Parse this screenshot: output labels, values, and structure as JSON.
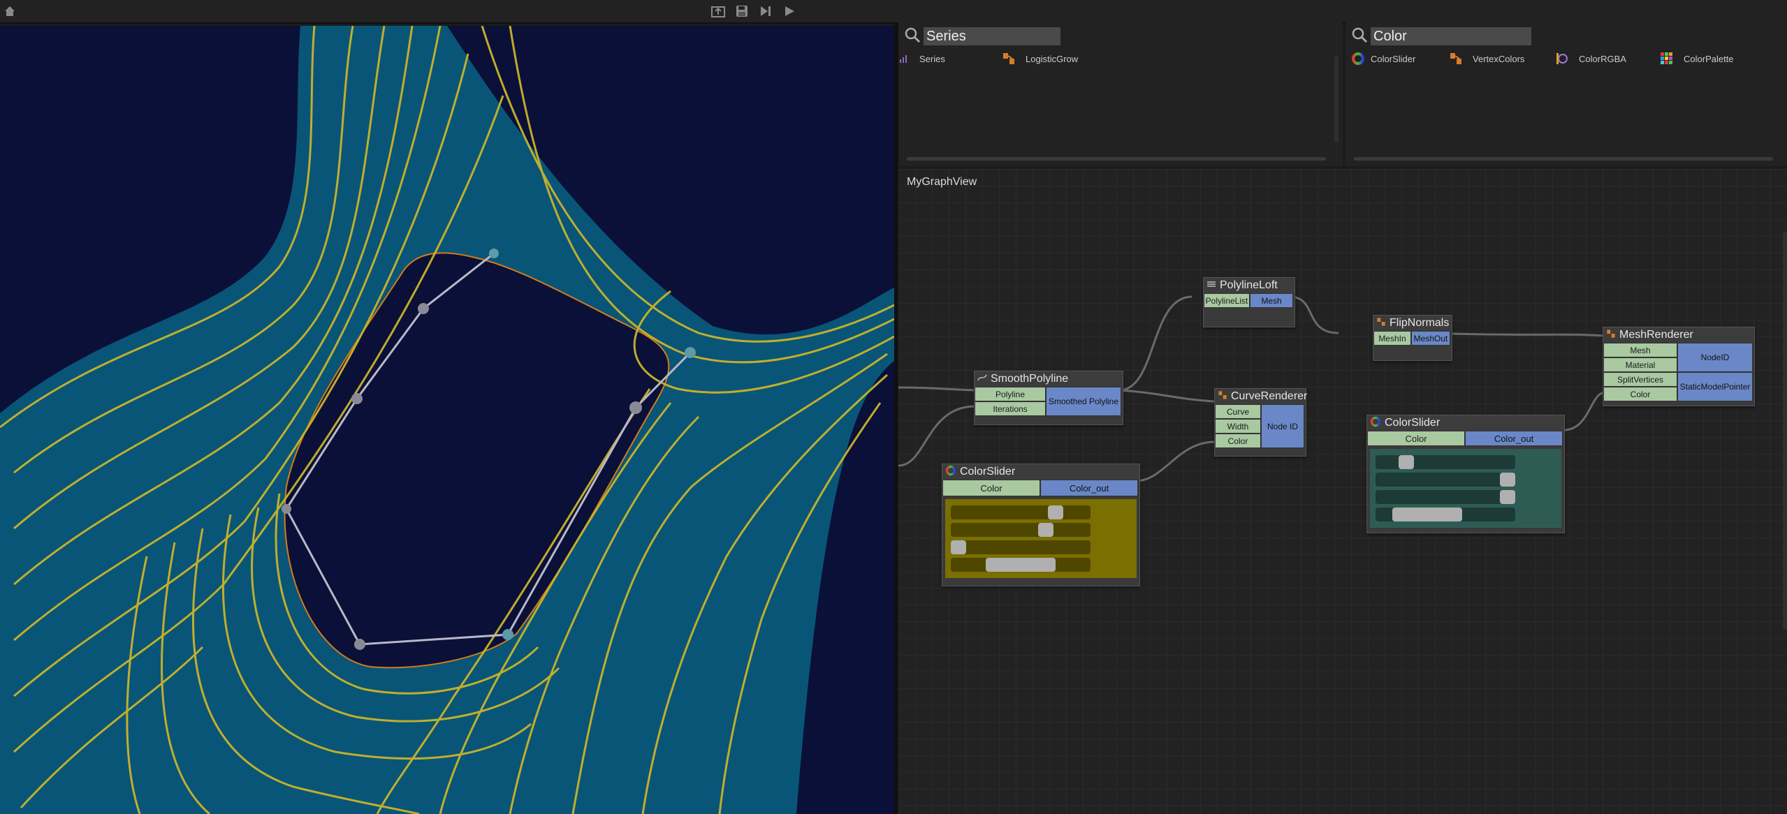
{
  "toolbar": {
    "icons": [
      "home-icon",
      "export-icon",
      "save-icon",
      "step-icon",
      "play-icon"
    ]
  },
  "panels": {
    "series": {
      "search_value": "Series",
      "items": [
        {
          "label": "Series",
          "icon": "series-icon"
        },
        {
          "label": "LogisticGrow",
          "icon": "node-icon"
        }
      ]
    },
    "color": {
      "search_value": "Color",
      "items": [
        {
          "label": "ColorSlider",
          "icon": "color-wheel-icon"
        },
        {
          "label": "VertexColors",
          "icon": "node-icon"
        },
        {
          "label": "ColorRGBA",
          "icon": "color-rgba-icon"
        },
        {
          "label": "ColorPalette",
          "icon": "palette-icon"
        }
      ]
    }
  },
  "graph": {
    "title": "MyGraphView",
    "nodes": {
      "polyline_loft": {
        "title": "PolylineLoft",
        "inputs": [
          "PolylineList"
        ],
        "outputs": [
          "Mesh"
        ]
      },
      "flip_normals": {
        "title": "FlipNormals",
        "inputs": [
          "MeshIn"
        ],
        "outputs": [
          "MeshOut"
        ]
      },
      "mesh_renderer": {
        "title": "MeshRenderer",
        "inputs": [
          "Mesh",
          "Material",
          "SplitVertices",
          "Color"
        ],
        "outputs": [
          "NodeID",
          "StaticModelPointer"
        ]
      },
      "smooth_polyline": {
        "title": "SmoothPolyline",
        "inputs": [
          "Polyline",
          "Iterations"
        ],
        "outputs": [
          "Smoothed Polyline"
        ]
      },
      "curve_renderer": {
        "title": "CurveRenderer",
        "inputs": [
          "Curve",
          "Width",
          "Color"
        ],
        "outputs": [
          "Node ID"
        ]
      },
      "color_slider_1": {
        "title": "ColorSlider",
        "inputs": [
          "Color"
        ],
        "outputs": [
          "Color_out"
        ],
        "slider_values": [
          0.75,
          0.68,
          0.05,
          0.5
        ],
        "background": "#7a6f00",
        "track": "#4f4600"
      },
      "color_slider_2": {
        "title": "ColorSlider",
        "inputs": [
          "Color"
        ],
        "outputs": [
          "Color_out"
        ],
        "slider_values": [
          0.22,
          0.95,
          0.95,
          0.37
        ],
        "background": "#2e5c55",
        "track": "#1c3a36"
      }
    }
  },
  "colors": {
    "viewport_bg": "#0b1038",
    "surface": "#0a5a7a",
    "contour": "#c9b42a",
    "control_polygon": "#b8b8c8",
    "pin_input": "#a9c9a1",
    "pin_output": "#6a88c8"
  }
}
